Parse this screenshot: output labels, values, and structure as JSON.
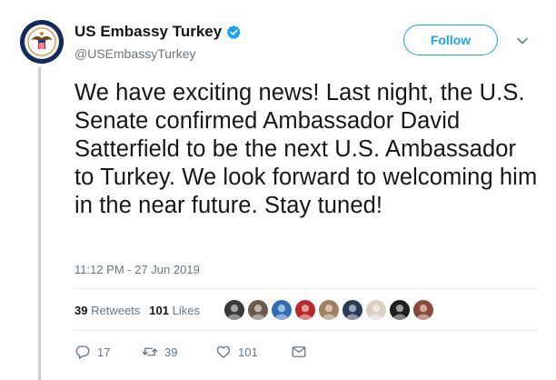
{
  "account": {
    "display_name": "US Embassy Turkey",
    "handle": "@USEmbassyTurkey",
    "verified_icon": "verified-badge-icon",
    "avatar_icon": "embassy-seal-avatar"
  },
  "header": {
    "follow_label": "Follow",
    "caret_icon": "chevron-down-icon"
  },
  "tweet": {
    "text": "We have exciting news! Last night, the U.S. Senate confirmed Ambassador David Satterfield to be the next U.S. Ambassador to Turkey. We look forward to welcoming him in the near future. Stay tuned!",
    "timestamp": "11:12 PM - 27 Jun 2019"
  },
  "stats": {
    "retweets_count": "39",
    "retweets_label": "Retweets",
    "likes_count": "101",
    "likes_label": "Likes"
  },
  "likers": [
    {
      "name": "liker-avatar-1",
      "color": "#3a3a3a"
    },
    {
      "name": "liker-avatar-2",
      "color": "#6b5a4e"
    },
    {
      "name": "liker-avatar-3",
      "color": "#2f6fb5"
    },
    {
      "name": "liker-avatar-4",
      "color": "#b52a2a"
    },
    {
      "name": "liker-avatar-5",
      "color": "#a08060"
    },
    {
      "name": "liker-avatar-6",
      "color": "#2a3a5a"
    },
    {
      "name": "liker-avatar-7",
      "color": "#d9cfc3"
    },
    {
      "name": "liker-avatar-8",
      "color": "#1f1f1f"
    },
    {
      "name": "liker-avatar-9",
      "color": "#8a4a3a"
    }
  ],
  "actions": {
    "reply_count": "17",
    "retweet_count": "39",
    "like_count": "101",
    "reply_icon": "reply-icon",
    "retweet_icon": "retweet-icon",
    "like_icon": "heart-icon",
    "dm_icon": "message-icon"
  },
  "colors": {
    "accent": "#1da1f2",
    "secondary_text": "#657786",
    "rail": "#c4cfd6"
  }
}
